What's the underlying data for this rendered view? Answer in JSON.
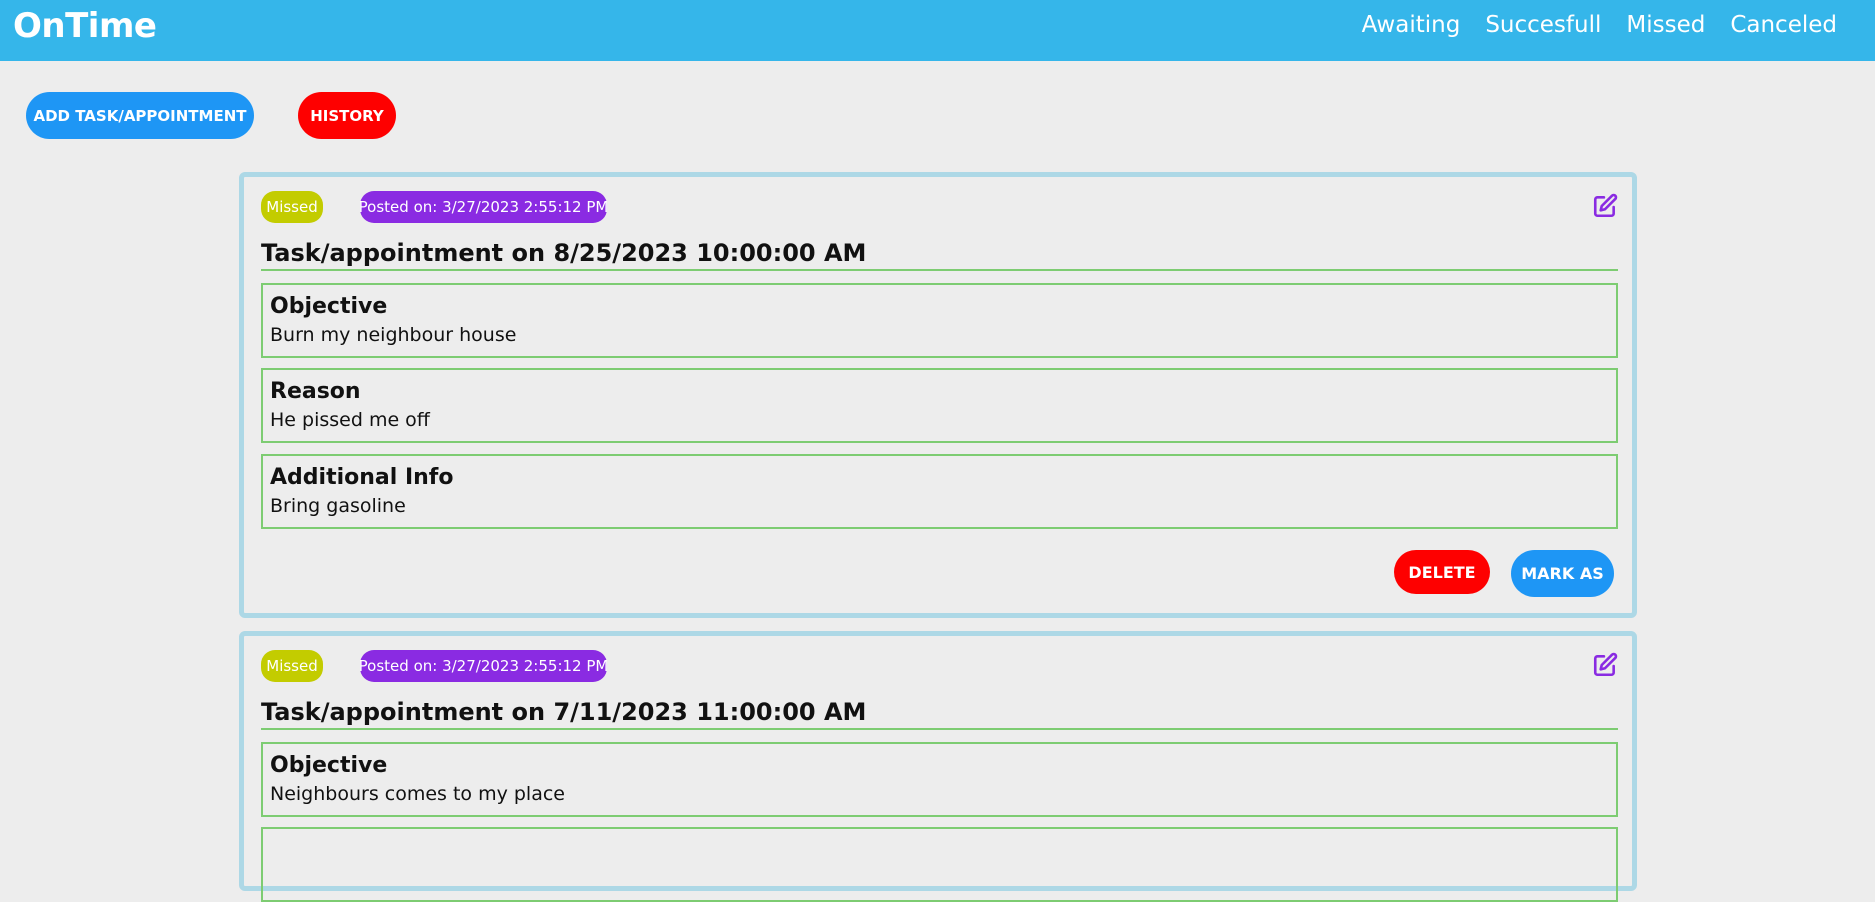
{
  "app": {
    "title": "OnTime"
  },
  "nav": {
    "items": [
      "Awaiting",
      "Succesfull",
      "Missed",
      "Canceled"
    ]
  },
  "toolbar": {
    "add_label": "ADD TASK/APPOINTMENT",
    "history_label": "HISTORY"
  },
  "colors": {
    "header": "#35b6ea",
    "primary": "#1e96f5",
    "danger": "#fe0000",
    "status_missed": "#c3cc00",
    "posted": "#8a2be2",
    "section_border": "#7dcc72",
    "card_border": "#add8e6"
  },
  "cards": [
    {
      "status": "Missed",
      "posted": "Posted on: 3/27/2023 2:55:12 PM",
      "title": "Task/appointment on 8/25/2023 10:00:00 AM",
      "sections": [
        {
          "heading": "Objective",
          "text": "Burn my neighbour house"
        },
        {
          "heading": "Reason",
          "text": "He pissed me off"
        },
        {
          "heading": "Additional Info",
          "text": "Bring gasoline"
        }
      ],
      "delete_label": "DELETE",
      "mark_label": "MARK AS",
      "edit_icon": "edit-icon"
    },
    {
      "status": "Missed",
      "posted": "Posted on: 3/27/2023 2:55:12 PM",
      "title": "Task/appointment on 7/11/2023 11:00:00 AM",
      "sections": [
        {
          "heading": "Objective",
          "text": "Neighbours comes to my place"
        }
      ],
      "edit_icon": "edit-icon"
    }
  ]
}
